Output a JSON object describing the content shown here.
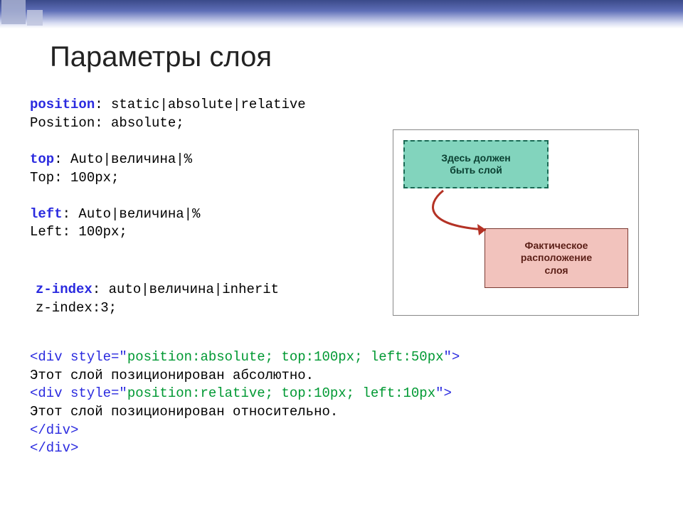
{
  "title": "Параметры слоя",
  "css_props": {
    "position_syntax": {
      "name": "position",
      "values": "static|absolute|relative"
    },
    "position_example": "Position: absolute;",
    "top_syntax": {
      "name": "top",
      "values": "Auto|величина|%"
    },
    "top_example": "Top: 100px;",
    "left_syntax": {
      "name": "left",
      "values": "Auto|величина|%"
    },
    "left_example": "Left: 100px;",
    "zindex_syntax": {
      "name": "z-index",
      "values": "auto|величина|inherit"
    },
    "zindex_example": "z-index:3;"
  },
  "illustration": {
    "top_box_line1": "Здесь должен",
    "top_box_line2": "быть слой",
    "bottom_box_line1": "Фактическое",
    "bottom_box_line2": "расположение",
    "bottom_box_line3": "слоя"
  },
  "html_example": {
    "line1_open": "<div style=\"",
    "line1_style": "position:absolute; top:100px; left:50px",
    "line1_close": "\">",
    "line2": "Этот слой позиционирован абсолютно.",
    "line3_open": "<div style=\"",
    "line3_style": "position:relative; top:10px; left:10px",
    "line3_close": "\">",
    "line4": "Этот слой позиционирован относительно.",
    "line5": "</div>",
    "line6": "</div>"
  }
}
